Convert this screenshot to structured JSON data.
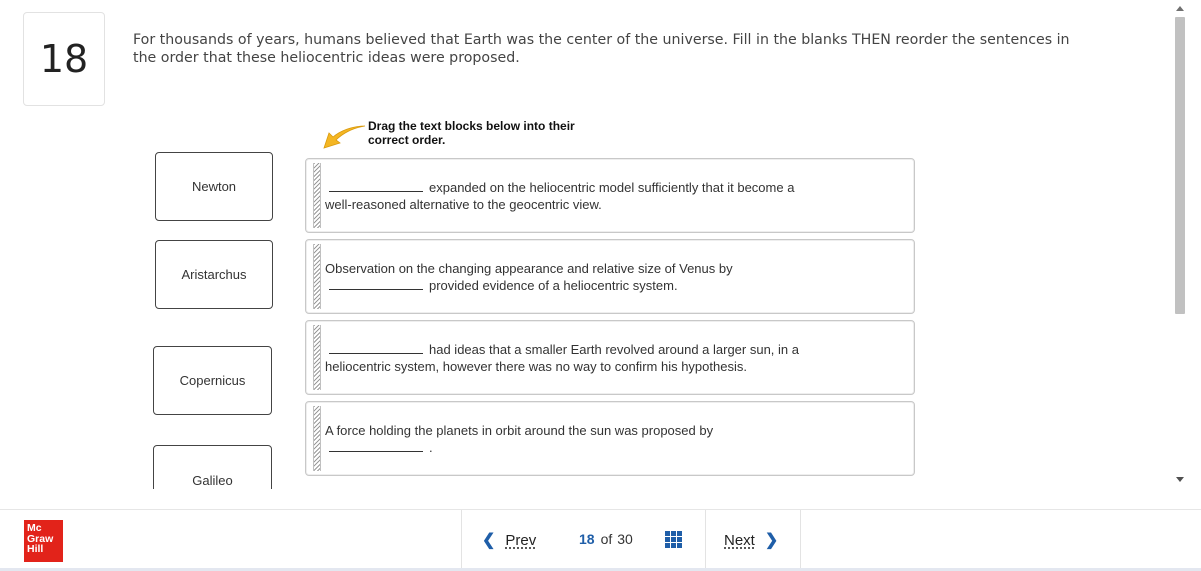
{
  "question": {
    "number": "18",
    "prompt": "For thousands of years, humans believed that Earth was the center of the universe. Fill in the blanks THEN reorder the sentences in the order that these heliocentric ideas were proposed."
  },
  "drag_hint": "Drag the text blocks below into their correct order.",
  "answer_tiles": [
    "Newton",
    "Aristarchus",
    "Copernicus",
    "Galileo"
  ],
  "sentences": [
    {
      "before": "",
      "after": "expanded on the heliocentric model sufficiently that it become a",
      "line2": "well-reasoned alternative to the geocentric view."
    },
    {
      "line1": "Observation on the changing appearance and relative size of Venus by",
      "after": "provided evidence of a heliocentric system."
    },
    {
      "before": "",
      "after": "had ideas that a smaller Earth revolved around a larger sun, in a",
      "line2": "heliocentric system, however there was no way to confirm his hypothesis."
    },
    {
      "line1": "A force holding the planets in orbit around the sun was proposed by",
      "after": "."
    }
  ],
  "footer": {
    "logo": [
      "Mc",
      "Graw",
      "Hill"
    ],
    "prev_label": "Prev",
    "current_page": "18",
    "of_label": "of",
    "total_pages": "30",
    "next_label": "Next"
  },
  "colors": {
    "accent_blue": "#1f5ea8",
    "logo_red": "#e2231a",
    "hint_arrow": "#f4b623"
  },
  "icons": [
    "drag-hint-arrow-icon",
    "chevron-left-icon",
    "chevron-right-icon",
    "grid-icon",
    "drag-grip-icon"
  ]
}
